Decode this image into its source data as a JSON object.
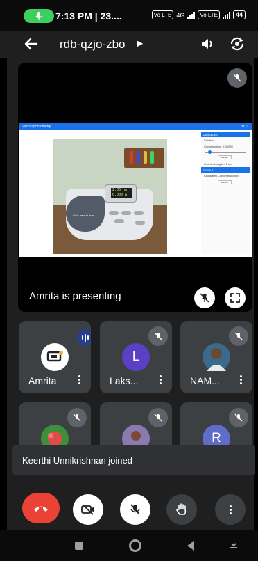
{
  "status_bar": {
    "time_text": "7:13 PM | 23....",
    "network_tag_1": "Vo LTE",
    "network_gen": "4G",
    "network_tag_2": "Vo LTE",
    "battery": "44"
  },
  "app_bar": {
    "meeting_code": "rdb-qzjo-zbo",
    "back_icon": "arrow-left-icon",
    "speaker_icon": "volume-icon",
    "switch_camera_icon": "switch-camera-icon"
  },
  "presentation": {
    "app_title": "Spectrophotometry",
    "display_text": [
      "2.00 nm",
      "0.000 A"
    ],
    "start_label": "Click here to start",
    "panel": {
      "header_1": "VARIABLES",
      "items": [
        "Solution",
        "Concentration: 0.002 M"
      ],
      "button_1": "RESET",
      "cuvette": "Cuvette Length = 1 cm",
      "header_2": "RESULT",
      "result_label": "Calculated Concentration(M)",
      "button_2": "SUBMIT"
    },
    "presenting_text": "Amrita is presenting"
  },
  "participants": [
    {
      "name": "Amrita",
      "avatar_letter": "",
      "avatar_color": "#ffffff",
      "state": "speaking"
    },
    {
      "name": "Laks...",
      "avatar_letter": "L",
      "avatar_color": "#5b3fc4",
      "state": "muted"
    },
    {
      "name": "NAM...",
      "avatar_letter": "",
      "avatar_color": "#3a6b8c",
      "state": "muted"
    },
    {
      "name": "",
      "avatar_letter": "",
      "avatar_color": "#3f8f3a",
      "state": "muted"
    },
    {
      "name": "",
      "avatar_letter": "",
      "avatar_color": "#8a7ab0",
      "state": "muted"
    },
    {
      "name": "",
      "avatar_letter": "R",
      "avatar_color": "#5e6ec8",
      "state": "muted"
    }
  ],
  "toast": {
    "text": "Keerthi Unnikrishnan joined"
  },
  "controls": {
    "end_call_color": "#ea4335",
    "items": [
      "end-call",
      "camera-off",
      "mic-off",
      "raise-hand",
      "more-options"
    ]
  },
  "colors": {
    "accent_green": "#3ccf5f",
    "brand_blue": "#1a73e8",
    "tile_gray": "#3c4043"
  }
}
